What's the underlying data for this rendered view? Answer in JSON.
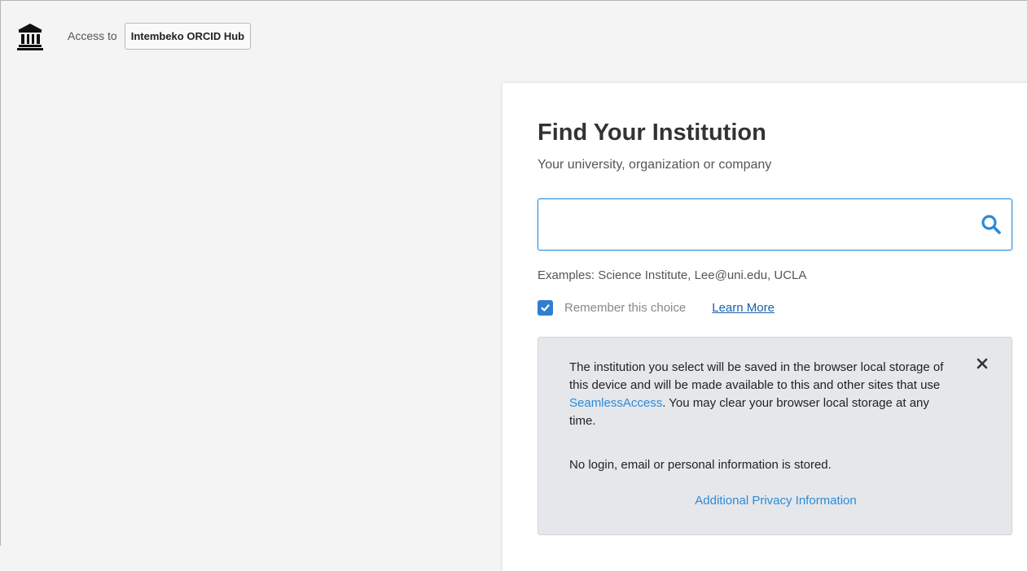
{
  "header": {
    "access_prefix": "Access to",
    "service_name": "Intembeko ORCID Hub",
    "logo_icon": "institution-icon"
  },
  "panel": {
    "title": "Find Your Institution",
    "subtitle": "Your university, organization or company",
    "search": {
      "value": "",
      "placeholder": "",
      "icon": "search-icon"
    },
    "examples": "Examples: Science Institute, Lee@uni.edu, UCLA",
    "remember": {
      "checked": true,
      "label": "Remember this choice",
      "learn_more": "Learn More"
    },
    "info": {
      "text_part1": "The institution you select will be saved in the browser local storage of this device and will be made available to this and other sites that use ",
      "link": "SeamlessAccess",
      "text_part2": ". You may clear your browser local storage at any time.",
      "text2": "No login, email or personal information is stored.",
      "privacy_link": "Additional Privacy Information",
      "close_icon": "close-icon"
    }
  },
  "colors": {
    "accent": "#2c8ad7",
    "checkbox": "#2f7ecf",
    "link_dark": "#1a5fa8",
    "info_bg": "#e5e7eb",
    "page_bg": "#f4f4f4"
  }
}
